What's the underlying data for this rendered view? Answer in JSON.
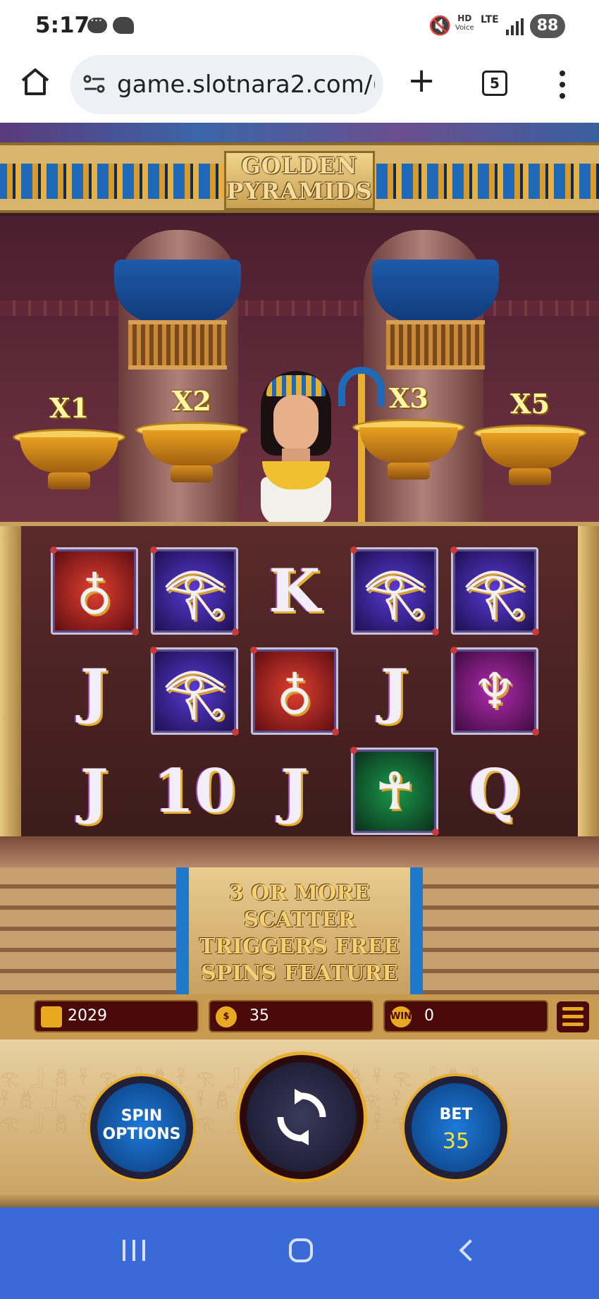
{
  "status_bar": {
    "time": "5:17",
    "icons": [
      "messenger-icon",
      "bird-icon",
      "mute-icon",
      "hd-voice-icon",
      "lte-icon",
      "signal-icon"
    ],
    "hd_label": "HD",
    "voice_label": "Voice",
    "lte_label": "LTE",
    "battery": "88"
  },
  "browser": {
    "url": "game.slotnara2.com/(",
    "tab_count": "5"
  },
  "game": {
    "title_line1": "GOLDEN",
    "title_line2": "PYRAMIDS",
    "multipliers": [
      "X1",
      "X2",
      "X3",
      "X5"
    ],
    "reels": [
      [
        {
          "symbol": "red-vase",
          "glyph": "♁",
          "frame": "red"
        },
        {
          "symbol": "J",
          "glyph": "J",
          "frame": "none"
        },
        {
          "symbol": "J",
          "glyph": "J",
          "frame": "none"
        }
      ],
      [
        {
          "symbol": "eye-of-horus",
          "glyph": "𓂀",
          "frame": "purple"
        },
        {
          "symbol": "eye-of-horus",
          "glyph": "𓂀",
          "frame": "purple"
        },
        {
          "symbol": "10",
          "glyph": "10",
          "frame": "none"
        }
      ],
      [
        {
          "symbol": "K",
          "glyph": "K",
          "frame": "none"
        },
        {
          "symbol": "red-vase",
          "glyph": "♁",
          "frame": "red"
        },
        {
          "symbol": "J",
          "glyph": "J",
          "frame": "none"
        }
      ],
      [
        {
          "symbol": "eye-of-horus",
          "glyph": "𓂀",
          "frame": "purple"
        },
        {
          "symbol": "J",
          "glyph": "J",
          "frame": "none"
        },
        {
          "symbol": "green-ankh",
          "glyph": "☥",
          "frame": "green"
        }
      ],
      [
        {
          "symbol": "eye-of-horus",
          "glyph": "𓂀",
          "frame": "purple"
        },
        {
          "symbol": "purple-jewel-chalice",
          "glyph": "♆",
          "frame": "magenta"
        },
        {
          "symbol": "Q",
          "glyph": "Q",
          "frame": "none"
        }
      ]
    ],
    "scatter_text": [
      "3 OR MORE",
      "SCATTER",
      "TRIGGERS FREE",
      "SPINS FEATURE"
    ],
    "hud": {
      "balance": "2029",
      "coin_value": "35",
      "coin_icon_label": "$",
      "win_label": "WIN",
      "win": "0"
    },
    "controls": {
      "spin_options_line1": "SPIN",
      "spin_options_line2": "OPTIONS",
      "bet_label": "BET",
      "bet_value": "35"
    }
  }
}
